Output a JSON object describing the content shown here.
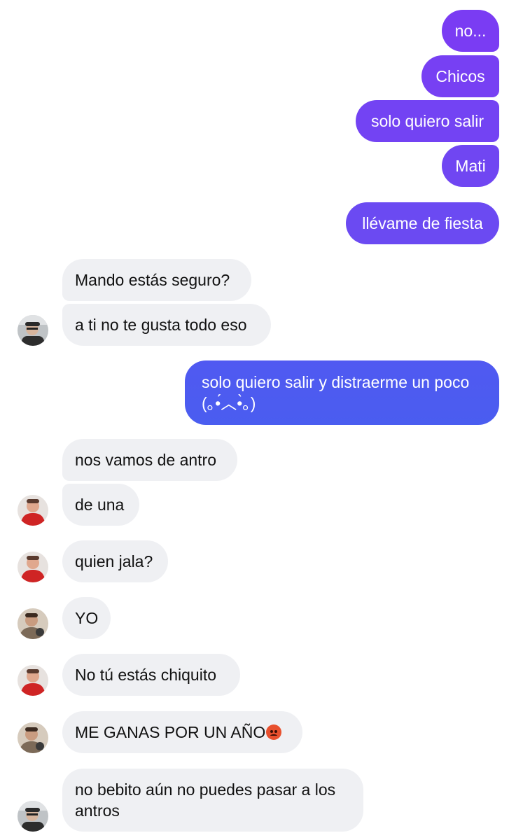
{
  "outgoing": [
    {
      "text": "no..."
    },
    {
      "text": "Chicos"
    },
    {
      "text": "solo quiero salir"
    },
    {
      "text": "Mati"
    },
    {
      "text": "llévame de fiesta"
    },
    {
      "line1": "solo quiero salir y distraerme un poco",
      "line2": "(｡•́︿•̀｡)"
    }
  ],
  "incoming": [
    {
      "text": "Mando estás seguro?"
    },
    {
      "text": "a ti no te gusta todo eso"
    },
    {
      "text": "nos vamos de antro"
    },
    {
      "text": "de una"
    },
    {
      "text": "quien jala?"
    },
    {
      "text": "YO"
    },
    {
      "text": "No tú estás chiquito"
    },
    {
      "text": "ME GANAS POR UN AÑO",
      "emoji": "angry-face-emoji"
    },
    {
      "line1": "no bebito aún no puedes pasar a los",
      "line2": "antros"
    }
  ],
  "colors": {
    "outgoing_top": "#7a3cf3",
    "outgoing_bottom": "#4a5df0",
    "incoming_bg": "#eff0f3"
  }
}
